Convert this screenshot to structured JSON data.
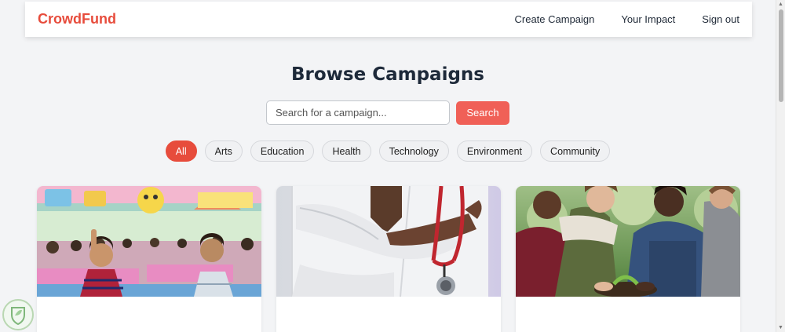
{
  "navbar": {
    "brand": "CrowdFund",
    "links": [
      "Create Campaign",
      "Your Impact",
      "Sign out"
    ]
  },
  "main": {
    "title": "Browse Campaigns",
    "search": {
      "placeholder": "Search for a campaign...",
      "value": "",
      "button_label": "Search"
    },
    "filters": [
      "All",
      "Arts",
      "Education",
      "Health",
      "Technology",
      "Environment",
      "Community"
    ],
    "active_filter": "All"
  },
  "campaigns": [
    {
      "image": "classroom-children-photo"
    },
    {
      "image": "doctor-stethoscope-photo"
    },
    {
      "image": "volunteers-planting-photo"
    }
  ],
  "colors": {
    "brand": "#e74c3c",
    "search_button": "#f06057",
    "heading": "#1e2a3a",
    "background": "#f3f4f6"
  },
  "icons": {
    "overlay_badge": "shield-leaf-icon"
  }
}
